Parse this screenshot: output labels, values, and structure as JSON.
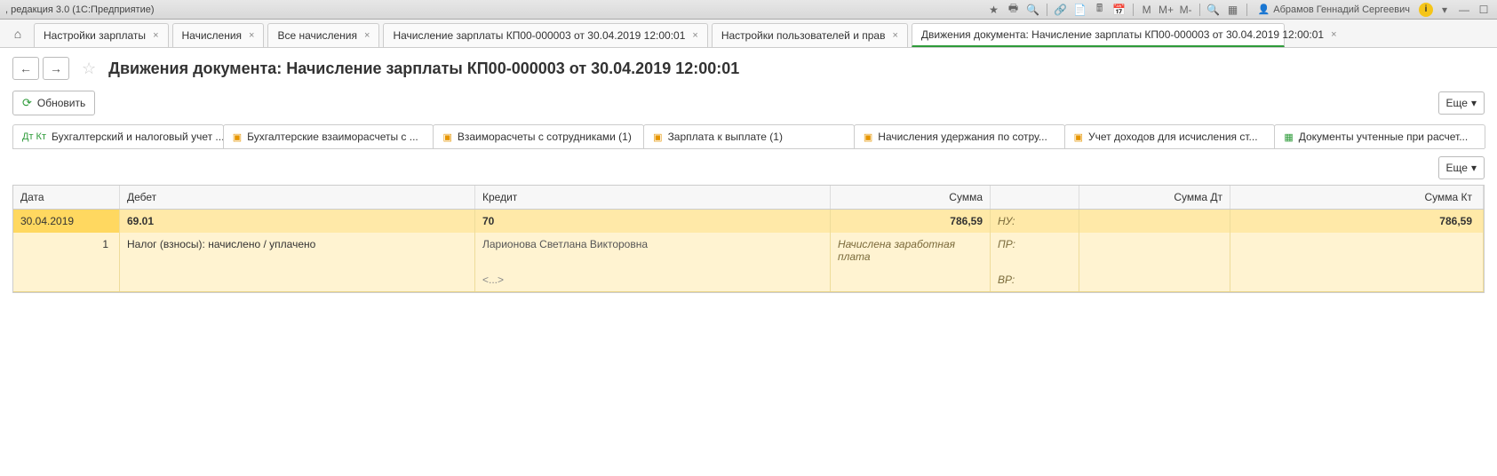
{
  "titlebar": {
    "title": ", редакция 3.0  (1С:Предприятие)",
    "user_name": "Абрамов Геннадий Сергеевич",
    "m_labels": [
      "M",
      "M+",
      "M-"
    ]
  },
  "tabs": [
    {
      "label": "Настройки зарплаты"
    },
    {
      "label": "Начисления"
    },
    {
      "label": "Все начисления"
    },
    {
      "label": "Начисление зарплаты КП00-000003 от 30.04.2019 12:00:01"
    },
    {
      "label": "Настройки пользователей и прав"
    },
    {
      "label": "Движения документа: Начисление зарплаты КП00-000003 от 30.04.2019 12:00:01",
      "active": true
    }
  ],
  "page": {
    "title": "Движения документа: Начисление зарплаты КП00-000003 от 30.04.2019 12:00:01"
  },
  "toolbar": {
    "refresh": "Обновить",
    "more": "Еще"
  },
  "subtabs": [
    {
      "label": "Бухгалтерский и налоговый учет ...",
      "active": true,
      "icon": "dtkt"
    },
    {
      "label": "Бухгалтерские взаиморасчеты с ..."
    },
    {
      "label": "Взаиморасчеты с сотрудниками (1)"
    },
    {
      "label": "Зарплата к выплате (1)"
    },
    {
      "label": "Начисления удержания по сотру..."
    },
    {
      "label": "Учет доходов для исчисления ст..."
    },
    {
      "label": "Документы учтенные при расчет..."
    }
  ],
  "table": {
    "headers": {
      "date": "Дата",
      "debit": "Дебет",
      "credit": "Кредит",
      "sum": "Сумма",
      "sub": "",
      "sum_dt": "Сумма Дт",
      "sum_kt": "Сумма Кт"
    },
    "row1": {
      "date": "30.04.2019",
      "debit": "69.01",
      "credit": "70",
      "sum": "786,59",
      "sub": "НУ:",
      "sum_kt": "786,59"
    },
    "row2": {
      "num": "1",
      "debit": "Налог (взносы): начислено / уплачено",
      "credit": "Ларионова Светлана Викторовна",
      "sum": "Начислена заработная плата",
      "sub": "ПР:"
    },
    "row3": {
      "credit": "<...>",
      "sub": "ВР:"
    }
  }
}
